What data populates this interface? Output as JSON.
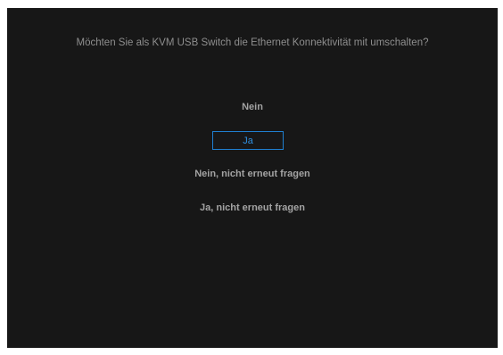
{
  "dialog": {
    "question": "Möchten Sie als KVM USB Switch die Ethernet Konnektivität mit umschalten?",
    "options": [
      {
        "label": "Nein",
        "selected": false
      },
      {
        "label": "Ja",
        "selected": true
      },
      {
        "label": "Nein, nicht erneut fragen",
        "selected": false
      },
      {
        "label": "Ja, nicht erneut fragen",
        "selected": false
      }
    ]
  },
  "colors": {
    "background": "#171717",
    "text": "#a3a3a3",
    "selection": "#1f7fd0"
  }
}
